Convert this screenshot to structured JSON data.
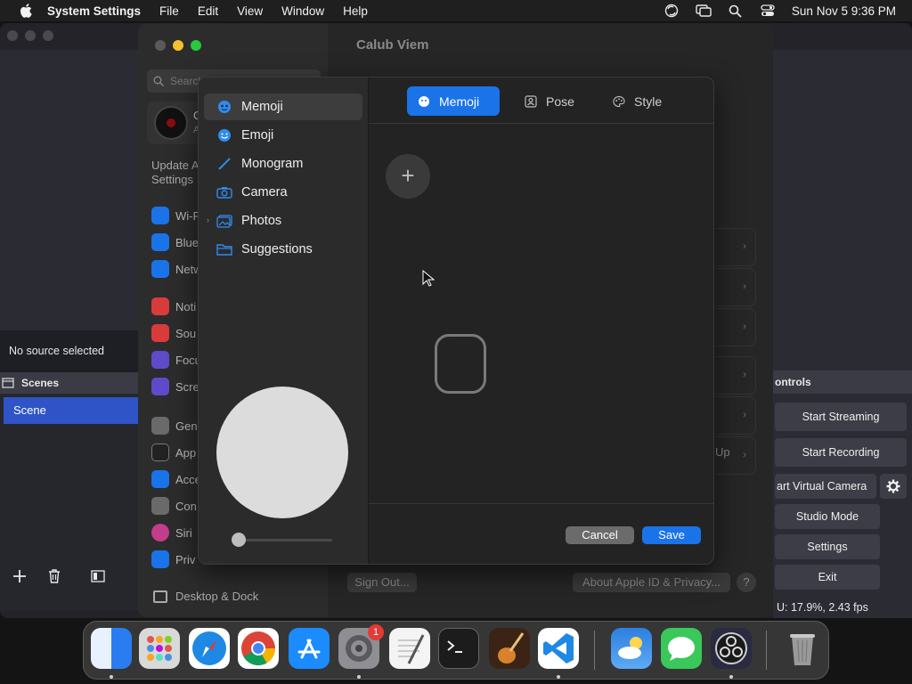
{
  "menubar": {
    "app_name": "System Settings",
    "menus": [
      "File",
      "Edit",
      "View",
      "Window",
      "Help"
    ],
    "clock": "Sun Nov 5  9:36 PM"
  },
  "obs": {
    "no_source": "No source selected",
    "scenes_header": "Scenes",
    "scene_item": "Scene",
    "controls_header": "ontrols",
    "buttons": {
      "start_streaming": "Start Streaming",
      "start_recording": "Start Recording",
      "virtual_camera": "art Virtual Camera",
      "studio_mode": "Studio Mode",
      "settings": "Settings",
      "exit": "Exit"
    },
    "status": "U: 17.9%, 2.43 fps"
  },
  "settings": {
    "window_title": "Calub Viem",
    "search_placeholder": "Search",
    "user_initial": "C",
    "user_sub": "A",
    "update_line1": "Update A",
    "update_line2": "Settings",
    "sidebar_items": [
      "Wi-F",
      "Blue",
      "Netw",
      "Noti",
      "Sou",
      "Focu",
      "Scre",
      "Gen",
      "App",
      "Acce",
      "Con",
      "Siri",
      "Priv"
    ],
    "desktop_dock": "Desktop & Dock",
    "up_label": "Up",
    "sign_out": "Sign Out...",
    "about": "About Apple ID & Privacy...",
    "help": "?"
  },
  "sheet": {
    "sources": [
      "Memoji",
      "Emoji",
      "Monogram",
      "Camera",
      "Photos",
      "Suggestions"
    ],
    "selected_source": "Memoji",
    "tabs": [
      "Memoji",
      "Pose",
      "Style"
    ],
    "active_tab": "Memoji",
    "add_symbol": "+",
    "cancel": "Cancel",
    "save": "Save",
    "zoom_level": 0
  },
  "dock": {
    "apps": [
      "finder-icon",
      "launchpad-icon",
      "safari-icon",
      "chrome-icon",
      "app-store-icon",
      "system-settings-icon",
      "textedit-icon",
      "terminal-icon",
      "garageband-icon",
      "vscode-icon",
      "weather-icon",
      "messages-icon",
      "obs-icon",
      "trash-icon"
    ],
    "settings_badge": "1"
  },
  "colors": {
    "accent": "#1a73e8",
    "obs_selection": "#2f54c8",
    "badge": "#e53935"
  }
}
